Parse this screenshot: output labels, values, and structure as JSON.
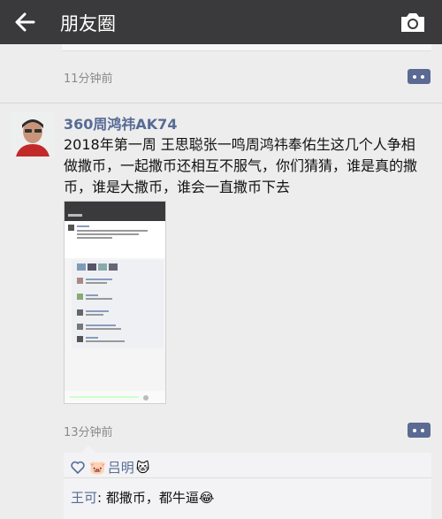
{
  "header": {
    "title": "朋友圈",
    "back_icon": "arrow-left-icon",
    "camera_icon": "camera-icon"
  },
  "prev_post": {
    "time": "11分钟前"
  },
  "post": {
    "author": "360周鸿祎AK74",
    "text": "2018年第一周 王思聪张一鸣周鸿祎奉佑生这几个人争相做撒币，一起撒币还相互不服气，你们猜猜，谁是真的撒币，谁是大撒币，谁会一直撒币下去",
    "time": "13分钟前",
    "likes": [
      "吕明"
    ],
    "comment": {
      "user": "王可",
      "sep": ": ",
      "text": "都撒币，都牛逼"
    }
  },
  "colors": {
    "topbar": "#3a3a3c",
    "link": "#576b95",
    "bg": "#ededed"
  }
}
